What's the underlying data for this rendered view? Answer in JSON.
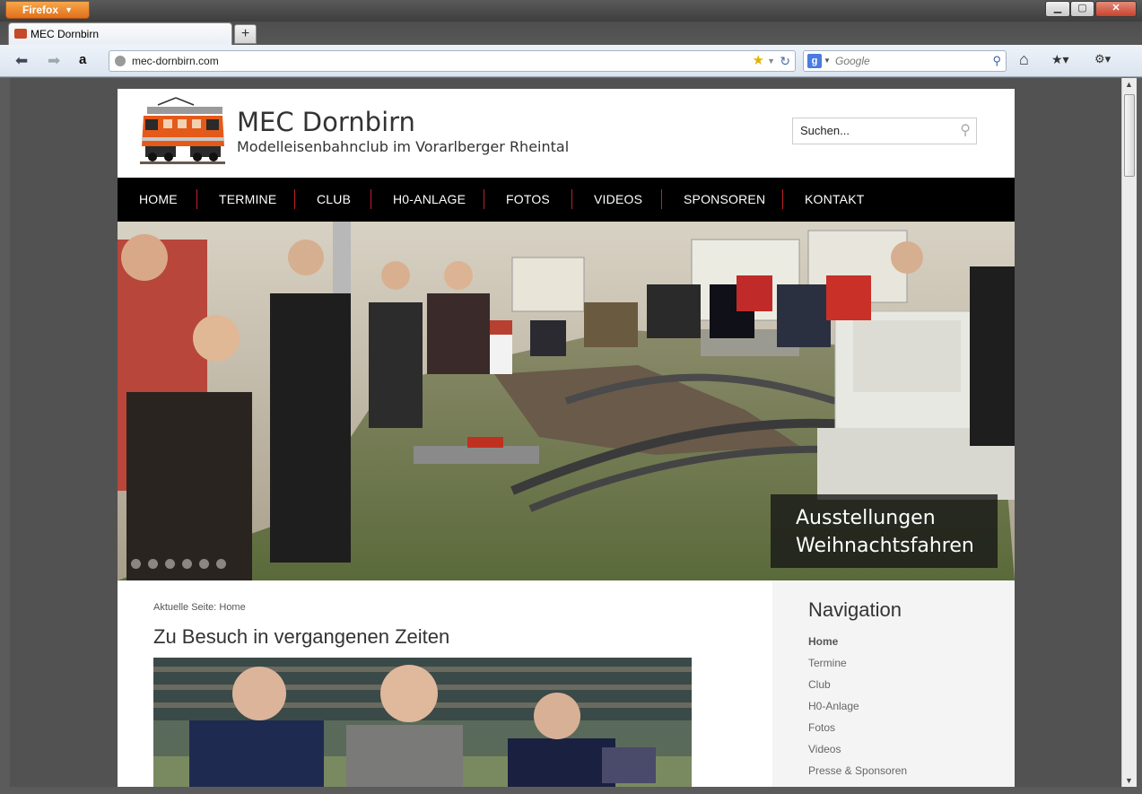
{
  "browser": {
    "app_button": "Firefox",
    "tab_title": "MEC Dornbirn",
    "url": "mec-dornbirn.com",
    "search_placeholder": "Google",
    "window_controls": {
      "minimize": "▁",
      "maximize": "▢",
      "close": "✕"
    }
  },
  "site": {
    "title": "MEC Dornbirn",
    "subtitle": "Modelleisenbahnclub im Vorarlberger Rheintal",
    "search_placeholder": "Suchen..."
  },
  "nav": {
    "items": [
      "HOME",
      "TERMINE",
      "CLUB",
      "H0-ANLAGE",
      "FOTOS",
      "VIDEOS",
      "SPONSOREN",
      "KONTAKT"
    ]
  },
  "slider": {
    "caption_line1": "Ausstellungen",
    "caption_line2": "Weihnachtsfahren",
    "dot_count": 6
  },
  "content": {
    "breadcrumb": "Aktuelle Seite: Home",
    "article_title": "Zu Besuch in vergangenen Zeiten"
  },
  "sidebar": {
    "heading": "Navigation",
    "items": [
      "Home",
      "Termine",
      "Club",
      "H0-Anlage",
      "Fotos",
      "Videos",
      "Presse & Sponsoren"
    ]
  },
  "colors": {
    "nav_background": "#000000",
    "nav_separator": "#c0202a",
    "page_background": "#525252",
    "sidebar_background": "#f4f4f4"
  }
}
